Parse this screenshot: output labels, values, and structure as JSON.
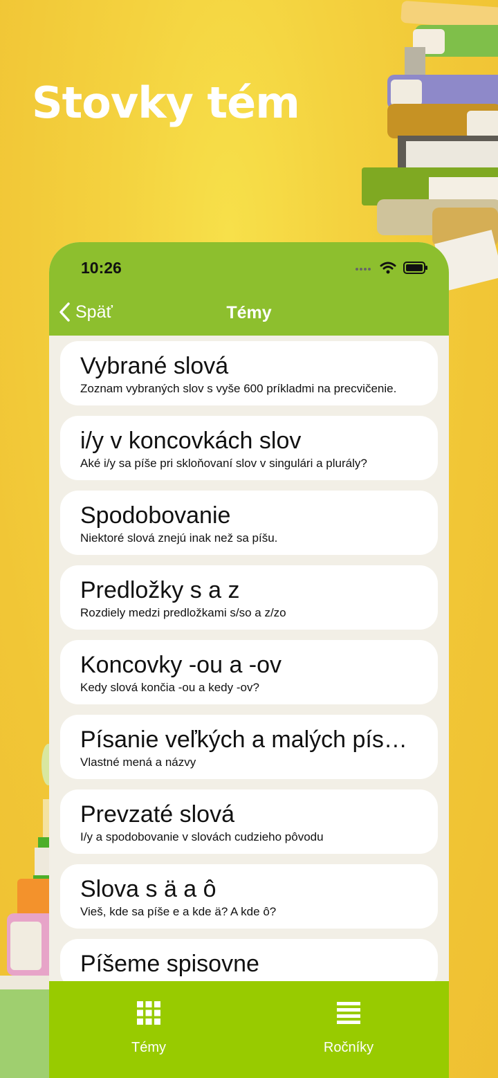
{
  "headline": "Stovky tém",
  "colors": {
    "background": "#f1c636",
    "header": "#8dbf2e",
    "tabbar": "#98cb00",
    "list_bg": "#f2efe6"
  },
  "status_bar": {
    "time": "10:26"
  },
  "nav": {
    "back_label": "Späť",
    "title": "Témy"
  },
  "topics": [
    {
      "title": "Vybrané slová",
      "subtitle": "Zoznam vybraných slov s vyše 600 príkladmi na precvičenie."
    },
    {
      "title": "i/y v koncovkách slov",
      "subtitle": "Aké i/y sa píše pri skloňovaní slov v singulári a plurály?"
    },
    {
      "title": "Spodobovanie",
      "subtitle": "Niektoré slová znejú inak než sa píšu."
    },
    {
      "title": "Predložky s a z",
      "subtitle": "Rozdiely medzi predložkami s/so a z/zo"
    },
    {
      "title": "Koncovky -ou a -ov",
      "subtitle": "Kedy slová končia -ou a kedy -ov?"
    },
    {
      "title": "Písanie veľkých a malých písmen",
      "subtitle": "Vlastné mená a názvy"
    },
    {
      "title": "Prevzaté slová",
      "subtitle": "I/y a spodobovanie v slovách cudzieho pôvodu"
    },
    {
      "title": "Slova s ä a ô",
      "subtitle": "Vieš, kde sa píše e a kde ä? A kde ô?"
    },
    {
      "title": "Píšeme spisovne",
      "subtitle": ""
    }
  ],
  "tabs": [
    {
      "label": "Témy",
      "icon": "grid-icon"
    },
    {
      "label": "Ročníky",
      "icon": "list-icon"
    }
  ]
}
